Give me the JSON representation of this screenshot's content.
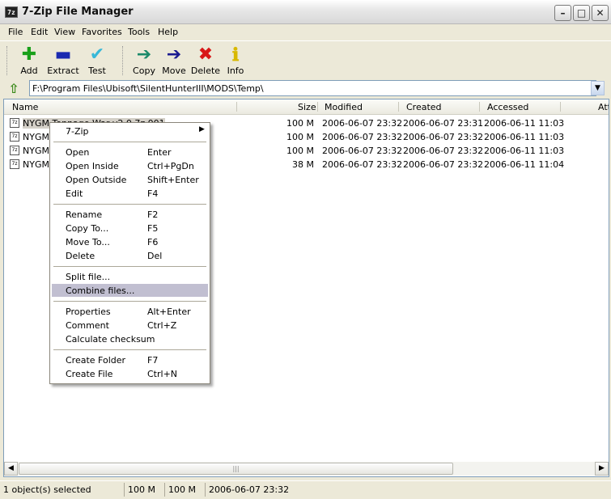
{
  "window": {
    "title": "7-Zip File Manager",
    "icon_text": "7z",
    "buttons": {
      "minimize": "–",
      "maximize": "□",
      "close": "✕"
    }
  },
  "menu": [
    "File",
    "Edit",
    "View",
    "Favorites",
    "Tools",
    "Help"
  ],
  "toolbar": {
    "add": {
      "label": "Add",
      "icon": "plus-icon",
      "color": "#1aa01a"
    },
    "extract": {
      "label": "Extract",
      "icon": "minus-icon",
      "color": "#1a2ab0"
    },
    "test": {
      "label": "Test",
      "icon": "check-icon",
      "color": "#38b8d8"
    },
    "copy": {
      "label": "Copy",
      "icon": "copy-arrow-icon",
      "color": "#1a8a6a"
    },
    "move": {
      "label": "Move",
      "icon": "move-arrow-icon",
      "color": "#1a1a90"
    },
    "delete": {
      "label": "Delete",
      "icon": "delete-x-icon",
      "color": "#d81818"
    },
    "info": {
      "label": "Info",
      "icon": "info-icon",
      "color": "#d8b800"
    }
  },
  "address": {
    "path": "F:\\Program Files\\Ubisoft\\SilentHunterIII\\MODS\\Temp\\"
  },
  "columns": [
    "Name",
    "Size",
    "Modified",
    "Created",
    "Accessed",
    "Att"
  ],
  "files": [
    {
      "name": "NYGM Tonnage War v2.0.7z.001",
      "size": "100 M",
      "modified": "2006-06-07 23:32",
      "created": "2006-06-07 23:31",
      "accessed": "2006-06-11 11:03",
      "selected": true
    },
    {
      "name": "NYGM",
      "size": "100 M",
      "modified": "2006-06-07 23:32",
      "created": "2006-06-07 23:32",
      "accessed": "2006-06-11 11:03",
      "selected": false
    },
    {
      "name": "NYGM T",
      "size": "100 M",
      "modified": "2006-06-07 23:32",
      "created": "2006-06-07 23:32",
      "accessed": "2006-06-11 11:03",
      "selected": false
    },
    {
      "name": "NYGM T",
      "size": "38 M",
      "modified": "2006-06-07 23:32",
      "created": "2006-06-07 23:32",
      "accessed": "2006-06-11 11:04",
      "selected": false
    }
  ],
  "context_menu": [
    {
      "label": "7-Zip",
      "shortcut": "",
      "submenu": true
    },
    {
      "label": "Open",
      "shortcut": "Enter"
    },
    {
      "label": "Open Inside",
      "shortcut": "Ctrl+PgDn"
    },
    {
      "label": "Open Outside",
      "shortcut": "Shift+Enter"
    },
    {
      "label": "Edit",
      "shortcut": "F4"
    },
    {
      "label": "Rename",
      "shortcut": "F2"
    },
    {
      "label": "Copy To...",
      "shortcut": "F5"
    },
    {
      "label": "Move To...",
      "shortcut": "F6"
    },
    {
      "label": "Delete",
      "shortcut": "Del"
    },
    {
      "label": "Split file...",
      "shortcut": ""
    },
    {
      "label": "Combine files...",
      "shortcut": "",
      "highlighted": true
    },
    {
      "label": "Properties",
      "shortcut": "Alt+Enter"
    },
    {
      "label": "Comment",
      "shortcut": "Ctrl+Z"
    },
    {
      "label": "Calculate checksum",
      "shortcut": ""
    },
    {
      "label": "Create Folder",
      "shortcut": "F7"
    },
    {
      "label": "Create File",
      "shortcut": "Ctrl+N"
    }
  ],
  "status": {
    "selected": "1 object(s) selected",
    "size": "100 M",
    "packed": "100 M",
    "date": "2006-06-07 23:32"
  },
  "scrollbar": {
    "grip": "|||"
  }
}
